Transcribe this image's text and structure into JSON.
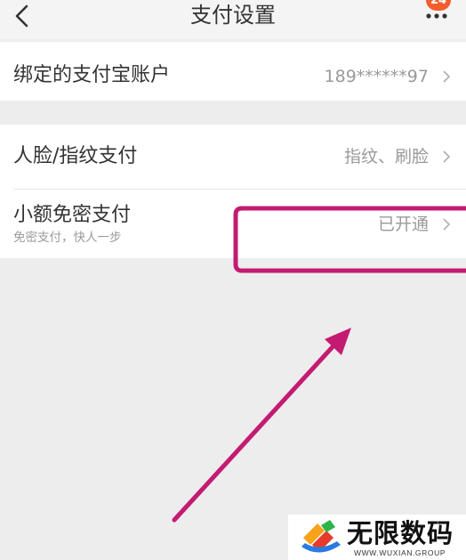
{
  "header": {
    "title": "支付设置",
    "badge": "24",
    "back_icon": "chevron-left-icon",
    "more_icon": "more-dots-icon"
  },
  "rows": [
    {
      "label": "绑定的支付宝账户",
      "value": "189******97"
    },
    {
      "label": "人脸/指纹支付",
      "value": "指纹、刷脸"
    },
    {
      "label": "小额免密支付",
      "sublabel": "免密支付，快人一步",
      "value": "已开通"
    }
  ],
  "row_icon": "chevron-right-icon",
  "watermark": {
    "brand": "无限数码",
    "url": "WWW.WUXIAN.GROUP",
    "logo_icon": "brand-logo-icon"
  },
  "colors": {
    "annotation": "#c41b72",
    "badge": "#f35d2c",
    "text_primary": "#333333",
    "text_secondary": "#9a9a9a"
  }
}
